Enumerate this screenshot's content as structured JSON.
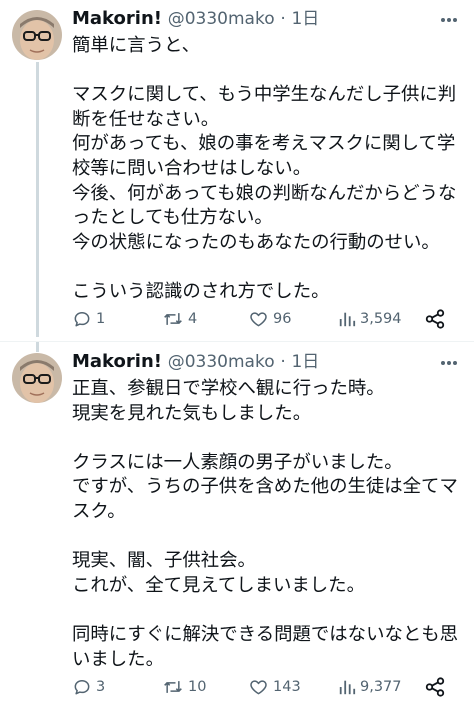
{
  "tweets": [
    {
      "display_name": "Makorin!",
      "handle": "@0330mako",
      "separator": "·",
      "time": "1日",
      "lines": [
        "簡単に言うと、",
        "",
        "マスクに関して、もう中学生なんだし子供に判",
        "断を任せなさい。",
        "何があっても、娘の事を考えマスクに関して学",
        "校等に問い合わせはしない。",
        "今後、何があっても娘の判断なんだからどうな",
        "ったとしても仕方ない。",
        "今の状態になったのもあなたの行動のせい。",
        "",
        "こういう認識のされ方でした。"
      ],
      "replies": "1",
      "retweets": "4",
      "likes": "96",
      "views": "3,594"
    },
    {
      "display_name": "Makorin!",
      "handle": "@0330mako",
      "separator": "·",
      "time": "1日",
      "lines": [
        "正直、参観日で学校へ観に行った時。",
        "現実を見れた気もしました。",
        "",
        "クラスには一人素顔の男子がいました。",
        "ですが、うちの子供を含めた他の生徒は全てマ",
        "スク。",
        "",
        "現実、闇、子供社会。",
        "これが、全て見えてしまいました。",
        "",
        "同時にすぐに解決できる問題ではないなとも思",
        "いました。"
      ],
      "replies": "3",
      "retweets": "10",
      "likes": "143",
      "views": "9,377"
    }
  ],
  "icons": {
    "reply": "reply-icon",
    "retweet": "retweet-icon",
    "like": "heart-icon",
    "views": "views-icon",
    "share": "share-icon",
    "more": "more-icon"
  },
  "colors": {
    "text": "#0f1419",
    "muted": "#536471",
    "thread_line": "#cfd9de"
  }
}
